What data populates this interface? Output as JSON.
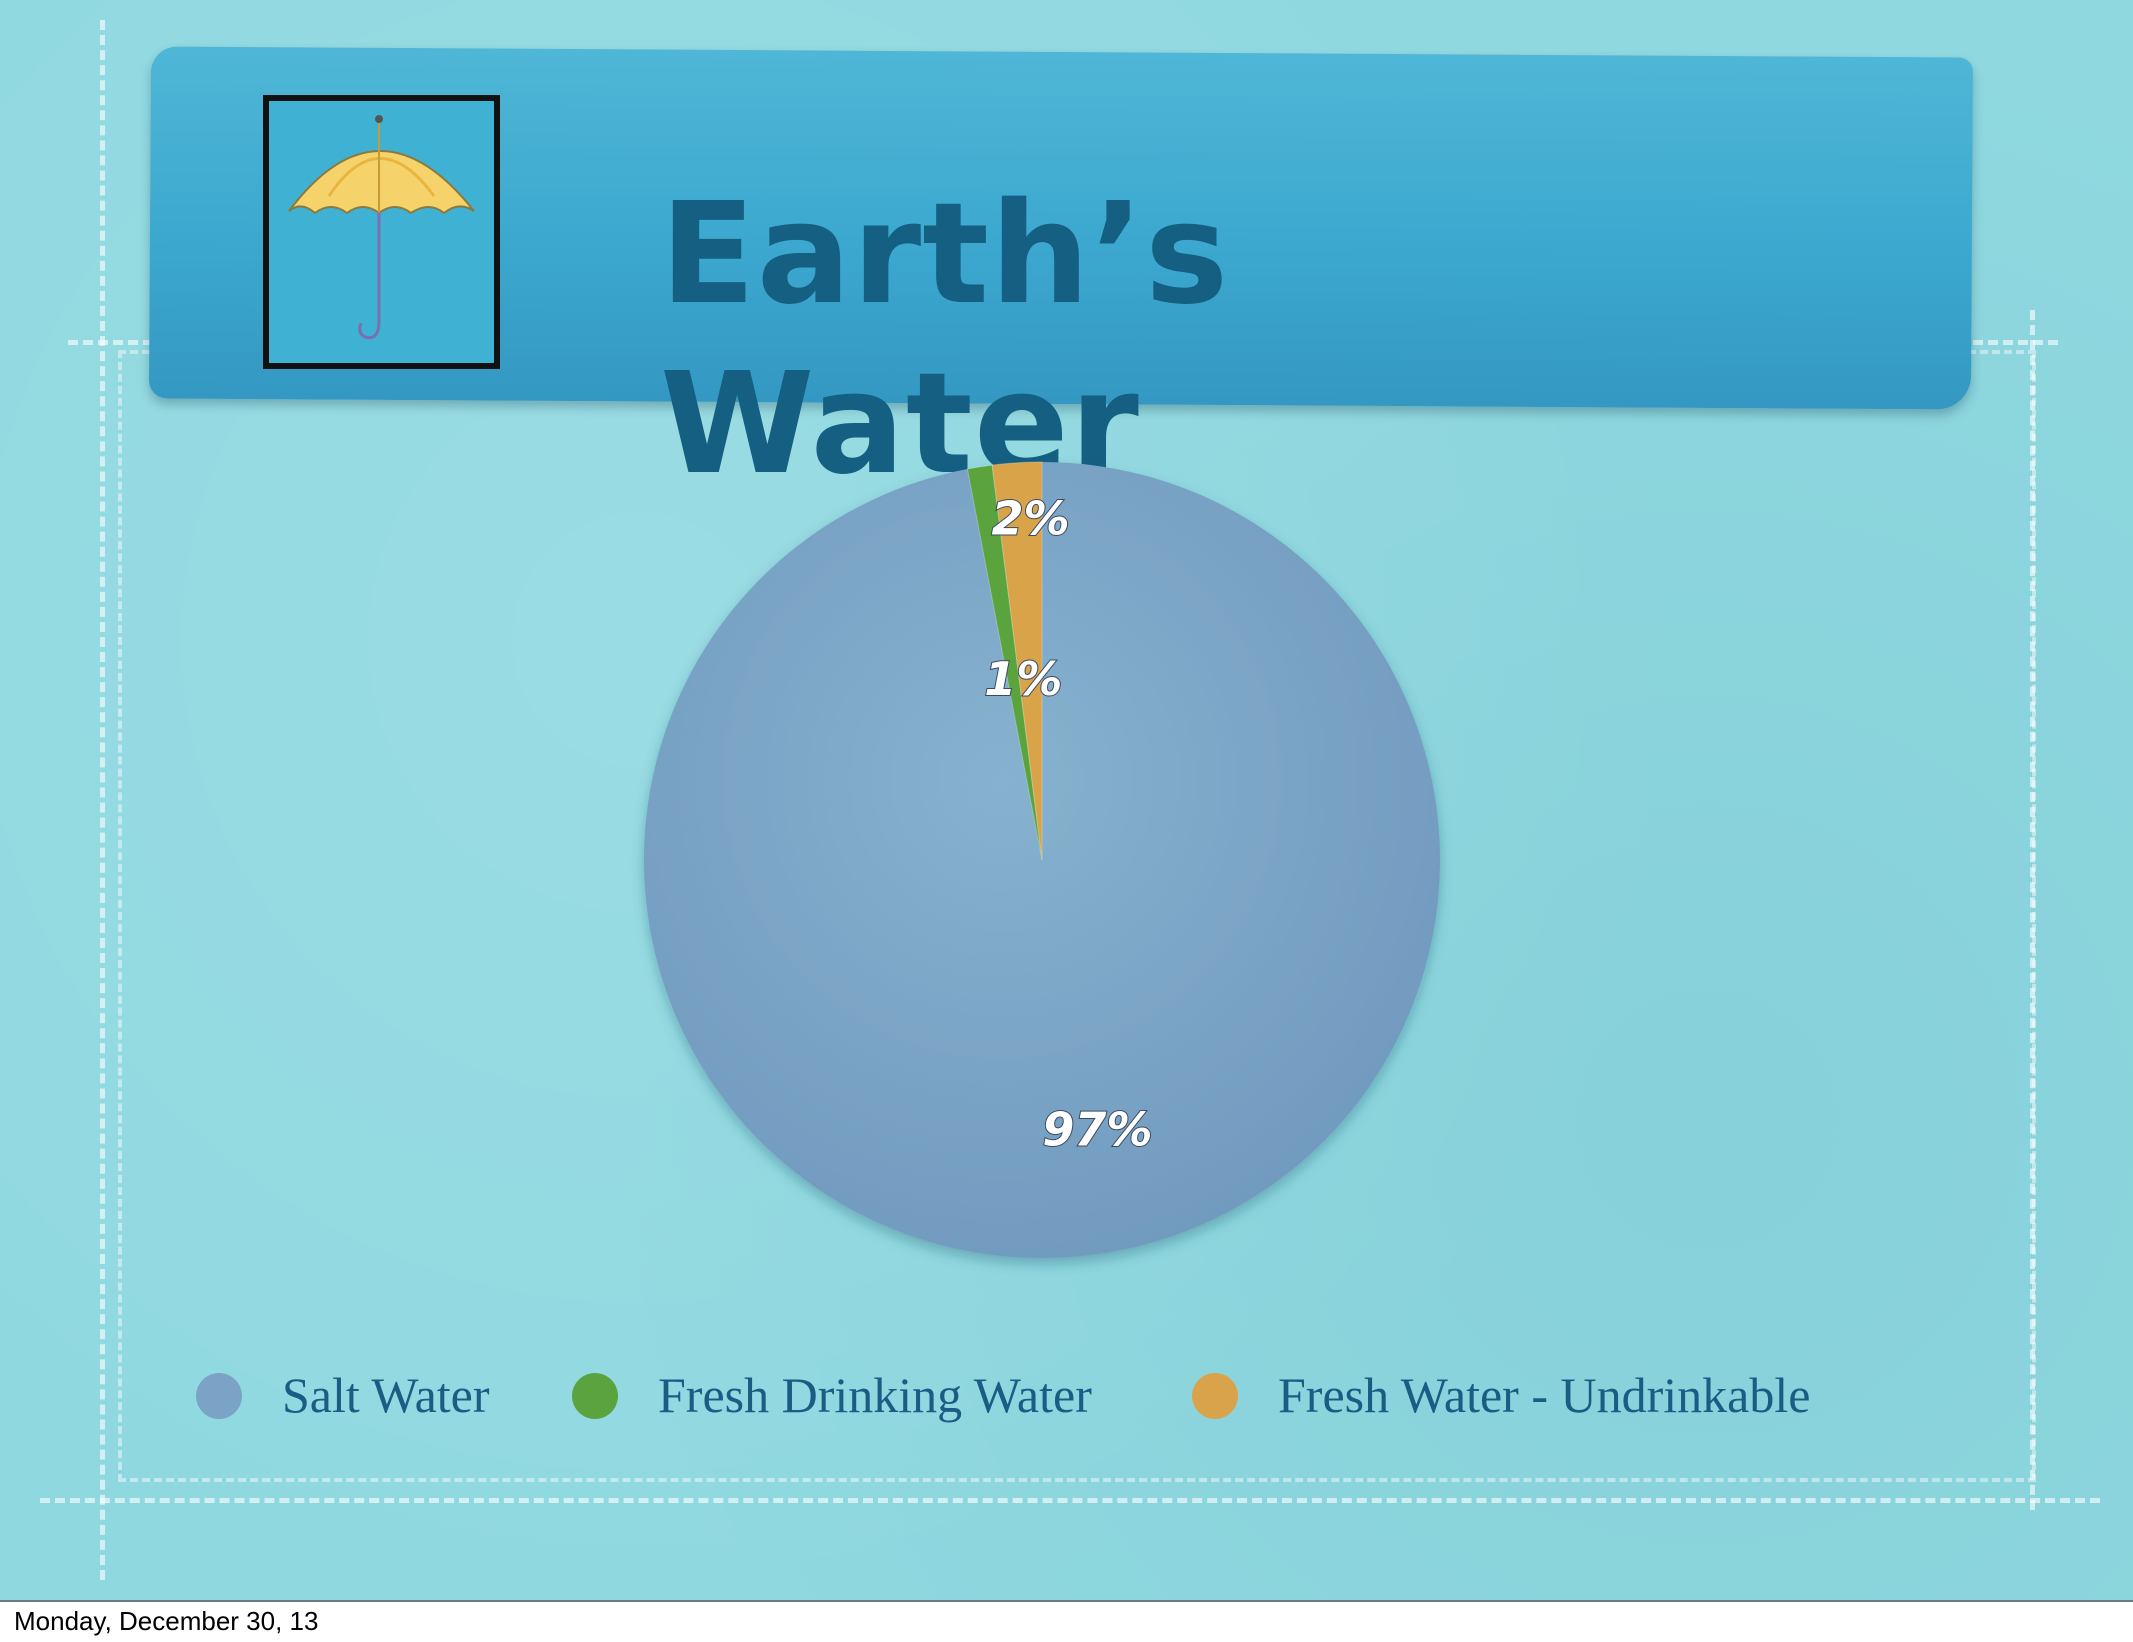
{
  "slide": {
    "title": "Earth’s Water",
    "footer_date": "Monday, December 30, 13"
  },
  "icons": {
    "umbrella": "umbrella-icon"
  },
  "colors": {
    "background": "#8fd8e0",
    "banner": "#3ca8cf",
    "title": "#145f82",
    "legend_text": "#1b5c85"
  },
  "chart_data": {
    "type": "pie",
    "title": "",
    "slices": [
      {
        "name": "Salt Water",
        "value": 97,
        "label": "97%",
        "color": "#7aa3c6"
      },
      {
        "name": "Fresh Drinking Water",
        "value": 1,
        "label": "1%",
        "color": "#5aa33e"
      },
      {
        "name": "Fresh Water - Undrinkable",
        "value": 2,
        "label": "2%",
        "color": "#d8a34a"
      }
    ],
    "legend": [
      "Salt Water",
      "Fresh Drinking Water",
      "Fresh Water - Undrinkable"
    ],
    "legend_position": "bottom"
  }
}
